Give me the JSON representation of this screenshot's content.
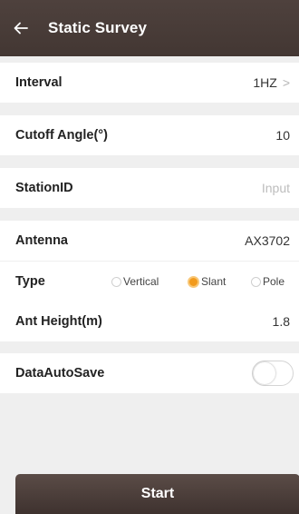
{
  "header": {
    "title": "Static Survey"
  },
  "rows": {
    "interval": {
      "label": "Interval",
      "value": "1HZ",
      "chevron": ">"
    },
    "cutoff_angle": {
      "label": "Cutoff Angle(°)",
      "value": "10"
    },
    "station_id": {
      "label": "StationID",
      "placeholder": "Input",
      "value": ""
    },
    "antenna": {
      "label": "Antenna",
      "value": "AX3702"
    },
    "type": {
      "label": "Type",
      "options": [
        "Vertical",
        "Slant",
        "Pole"
      ],
      "selected": "Slant"
    },
    "ant_height": {
      "label": "Ant Height(m)",
      "value": "1.8"
    },
    "data_auto_save": {
      "label": "DataAutoSave",
      "enabled": false
    }
  },
  "footer": {
    "start_label": "Start"
  },
  "colors": {
    "header_bg": "#463a36",
    "accent": "#f29a1c",
    "page_bg": "#efefef"
  }
}
